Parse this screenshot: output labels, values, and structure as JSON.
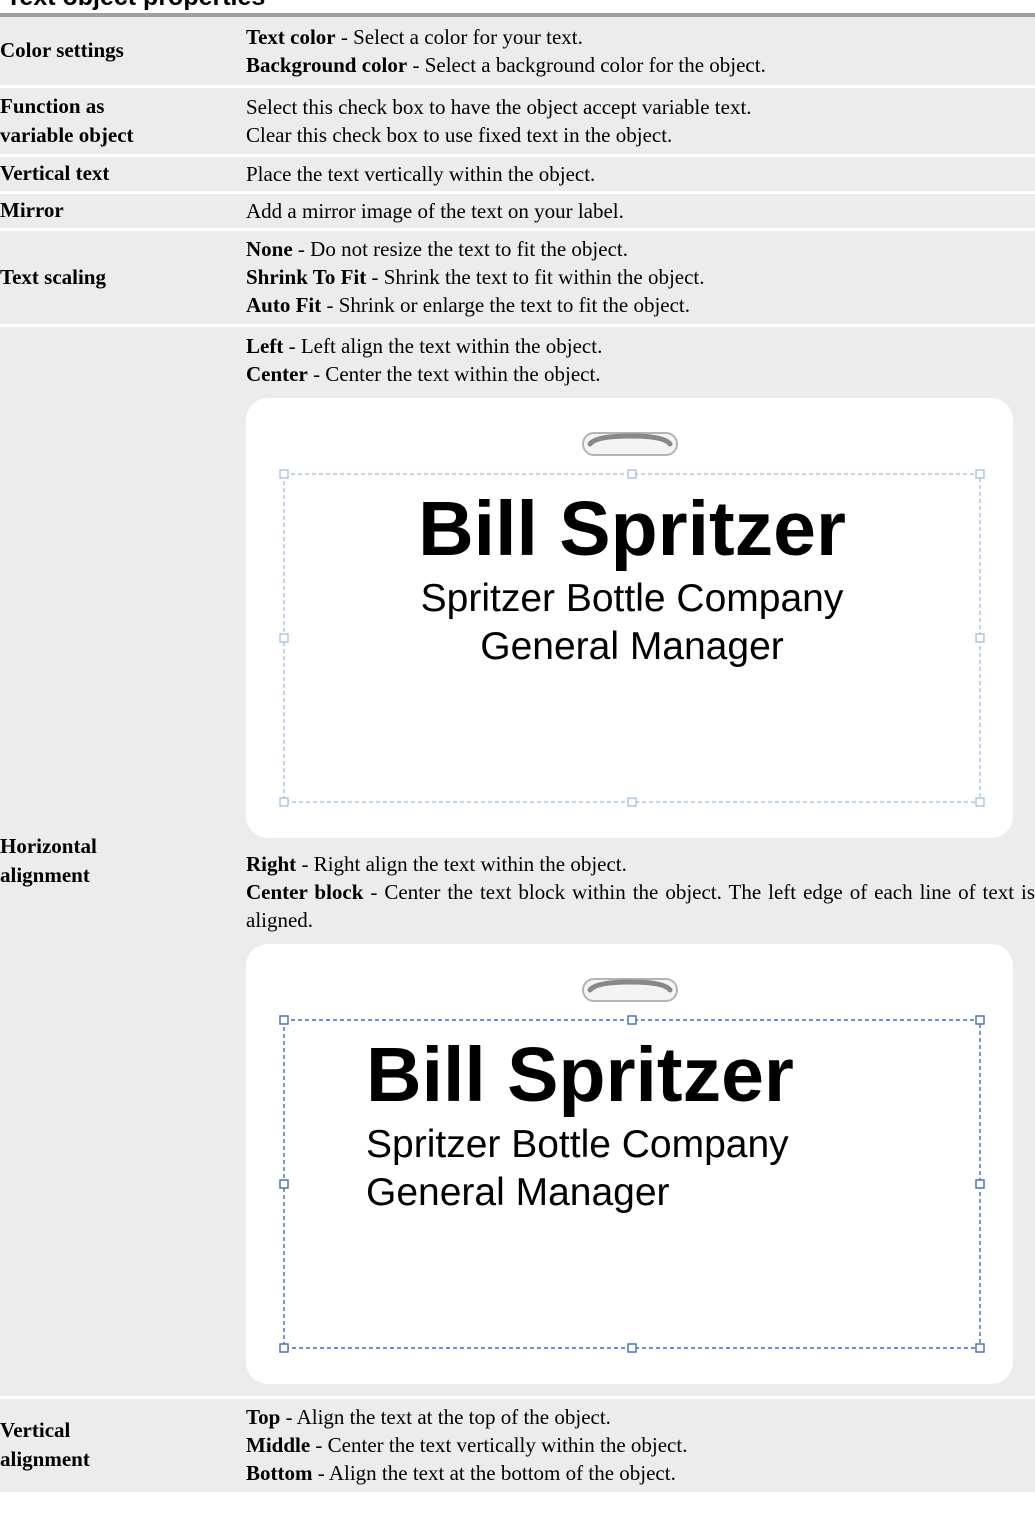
{
  "header": {
    "title": "Text object properties"
  },
  "rows": [
    {
      "label": "Color settings",
      "lines": [
        {
          "term": "Text color",
          "text": " - Select a color for your text."
        },
        {
          "term": "Background color",
          "text": " - Select a background color for the object."
        }
      ]
    },
    {
      "label_line1": "Function as",
      "label_line2": "variable object",
      "lines": [
        {
          "text": "Select this check box to have the object accept variable text."
        },
        {
          "text": "Clear this check box to use fixed text in the object."
        }
      ]
    },
    {
      "label": "Vertical text",
      "lines": [
        {
          "text": "Place the text vertically within the object."
        }
      ]
    },
    {
      "label": "Mirror",
      "lines": [
        {
          "text": "Add a mirror image of the text on your label."
        }
      ]
    },
    {
      "label": "Text scaling",
      "lines": [
        {
          "term": "None",
          "text": " - Do not resize the text to fit the object."
        },
        {
          "term": "Shrink To Fit",
          "text": " - Shrink the text to fit within the object."
        },
        {
          "term": "Auto Fit",
          "text": " - Shrink or enlarge the text to fit the object."
        }
      ]
    },
    {
      "label_line1": "Horizontal",
      "label_line2": "alignment",
      "lines_before": [
        {
          "term": "Left",
          "text": " - Left align the text within the object."
        },
        {
          "term": "Center",
          "text": " - Center the text within the object."
        }
      ],
      "badge1": {
        "name": "Bill Spritzer",
        "line1": "Spritzer Bottle Company",
        "line2": "General Manager"
      },
      "lines_middle": [
        {
          "term": "Right",
          "text": " - Right align the text within the object."
        },
        {
          "term": "Center block",
          "text": " - Center the text block within the object. The left edge of each line of text is aligned."
        }
      ],
      "badge2": {
        "name": "Bill Spritzer",
        "line1": "Spritzer Bottle Company",
        "line2": "General Manager"
      }
    },
    {
      "label_line1": "Vertical",
      "label_line2": "alignment",
      "lines": [
        {
          "term": "Top",
          "text": " - Align the text at the top of the object."
        },
        {
          "term": "Middle",
          "text": " - Center the text vertically within the object."
        },
        {
          "term": "Bottom",
          "text": " - Align the text at the bottom of the object."
        }
      ]
    }
  ],
  "colors": {
    "row_background": "#ececec",
    "header_rule": "#a0a0a0",
    "selection_light": "#9bb8e0",
    "selection_dark": "#3a6cc8"
  },
  "icons": [
    "badge-slot-icon",
    "resize-handle-icon"
  ]
}
